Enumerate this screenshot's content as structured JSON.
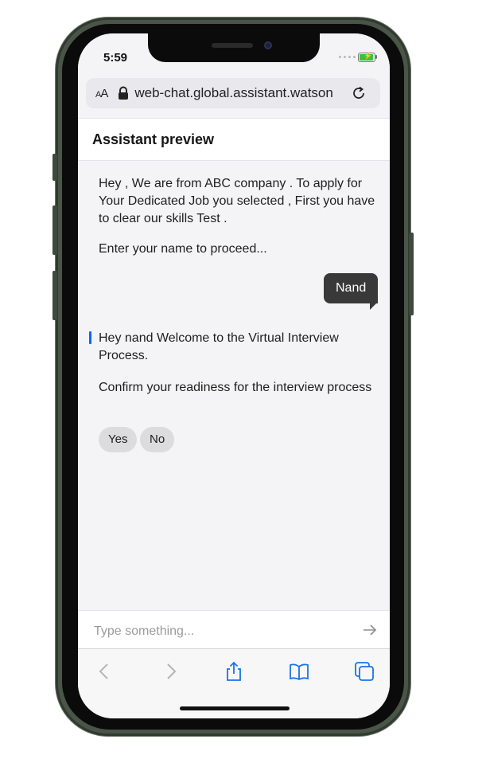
{
  "status_bar": {
    "time": "5:59",
    "battery_color": "#3cc13b"
  },
  "browser": {
    "text_size_label": "AA",
    "url": "web-chat.global.assistant.watson",
    "icons": [
      "lock-icon",
      "reload-icon"
    ]
  },
  "chat": {
    "header_title": "Assistant preview",
    "messages": [
      {
        "from": "bot",
        "text": "Hey , We are from ABC company . To apply for Your Dedicated Job you selected , First you have to clear our skills Test ."
      },
      {
        "from": "bot",
        "text": "Enter your name to proceed..."
      },
      {
        "from": "user",
        "text": "Nand"
      },
      {
        "from": "bot",
        "text": "Hey nand Welcome to the Virtual Interview Process."
      },
      {
        "from": "bot",
        "text": "Confirm your readiness for the interview process"
      }
    ],
    "quick_replies": [
      "Yes",
      "No"
    ],
    "input_placeholder": "Type something...",
    "accent_color": "#0f62fe",
    "user_bubble_color": "#393939"
  },
  "toolbar": {
    "icons": [
      "back-icon",
      "forward-icon",
      "share-icon",
      "bookmarks-icon",
      "tabs-icon"
    ],
    "active_color": "#1a73e8",
    "disabled_color": "#b5b5b5"
  }
}
